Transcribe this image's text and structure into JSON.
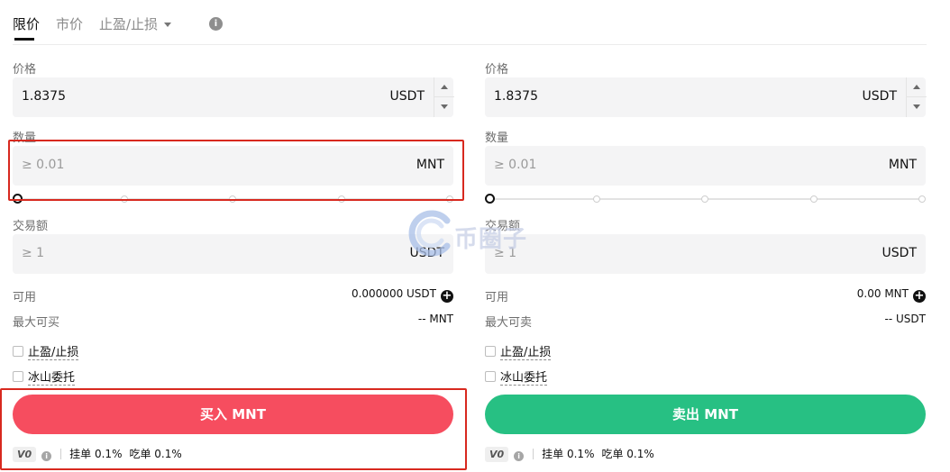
{
  "tabs": {
    "limit": "限价",
    "market": "市价",
    "tpsl": "止盈/止损"
  },
  "buy": {
    "price_label": "价格",
    "price_value": "1.8375",
    "price_unit": "USDT",
    "qty_label": "数量",
    "qty_placeholder": "≥ 0.01",
    "qty_unit": "MNT",
    "amount_label": "交易额",
    "amount_placeholder": "≥ 1",
    "amount_unit": "USDT",
    "available_label": "可用",
    "available_value": "0.000000 USDT",
    "max_label": "最大可买",
    "max_value": "-- MNT",
    "tpsl_check": "止盈/止损",
    "iceberg_check": "冰山委托",
    "button": "买入 MNT",
    "slider_percent": 0
  },
  "sell": {
    "price_label": "价格",
    "price_value": "1.8375",
    "price_unit": "USDT",
    "qty_label": "数量",
    "qty_placeholder": "≥ 0.01",
    "qty_unit": "MNT",
    "amount_label": "交易额",
    "amount_placeholder": "≥ 1",
    "amount_unit": "USDT",
    "available_label": "可用",
    "available_value": "0.00 MNT",
    "max_label": "最大可卖",
    "max_value": "-- USDT",
    "tpsl_check": "止盈/止损",
    "iceberg_check": "冰山委托",
    "button": "卖出 MNT",
    "slider_percent": 0
  },
  "fees": {
    "vip_level": "V0",
    "maker": "挂单 0.1%",
    "taker": "吃单 0.1%"
  },
  "watermark": "币圈子",
  "colors": {
    "buy": "#f64d5f",
    "sell": "#27c083",
    "annotation": "#d8291f"
  }
}
